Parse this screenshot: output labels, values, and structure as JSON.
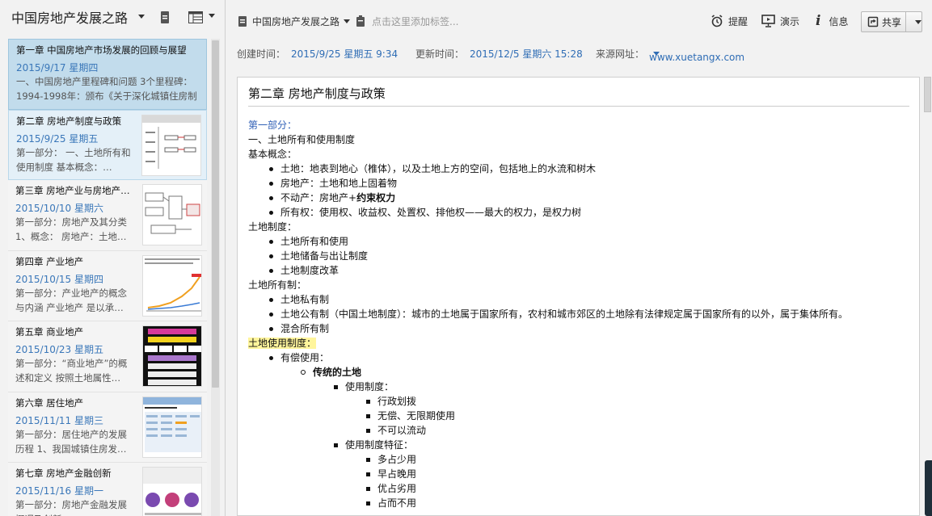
{
  "notebook": {
    "title": "中国房地产发展之路"
  },
  "notes": [
    {
      "title": "第一章 中国房地产市场发展的回顾与展望",
      "date": "2015/9/17 星期四",
      "snippet": "一、中国房地产里程碑和问题 3个里程碑： 1994-1998年：颁布《关于深化城镇住房制度改革的决定》…",
      "thumb": false
    },
    {
      "title": "第二章 房地产制度与政策",
      "date": "2015/9/25 星期五",
      "snippet": "第一部分： 一、土地所有和使用制度 基本概念：…",
      "thumb": true
    },
    {
      "title": "第三章 房地产业与房地产…",
      "date": "2015/10/10 星期六",
      "snippet": "第一部分：房地产及其分类 1、概念： 房地产：土地…",
      "thumb": true
    },
    {
      "title": "第四章 产业地产",
      "date": "2015/10/15 星期四",
      "snippet": "第一部分：产业地产的概念与内涵 产业地产 是以承…",
      "thumb": true
    },
    {
      "title": "第五章 商业地产",
      "date": "2015/10/23 星期五",
      "snippet": "第一部分：“商业地产”的概述和定义 按照土地属性…",
      "thumb": true
    },
    {
      "title": "第六章 居住地产",
      "date": "2015/11/11 星期三",
      "snippet": "第一部分：居住地产的发展历程 1、我国城镇住房发…",
      "thumb": true
    },
    {
      "title": "第七章 房地产金融创新",
      "date": "2015/11/16 星期一",
      "snippet": "第一部分：房地产金融发展概况及创新…",
      "thumb": true
    }
  ],
  "toolbar": {
    "note_title": "中国房地产发展之路",
    "tag_placeholder": "点击这里添加标签...",
    "remind": "提醒",
    "present": "演示",
    "info": "信息",
    "share": "共享"
  },
  "meta": {
    "created_label": "创建时间：",
    "created": "2015/9/25 星期五 9:34",
    "updated_label": "更新时间：",
    "updated": "2015/12/5 星期六 15:28",
    "source_label": "来源网址：",
    "source": "www.xuetangx.com"
  },
  "content": {
    "title": "第二章 房地产制度与政策",
    "lines": [
      {
        "text": "第一部分：",
        "indent": 0,
        "bullet": "none",
        "style": "blue"
      },
      {
        "text": "一、土地所有和使用制度",
        "indent": 0,
        "bullet": "none",
        "style": ""
      },
      {
        "text": "基本概念：",
        "indent": 0,
        "bullet": "none",
        "style": ""
      },
      {
        "text": "土地：地表到地心（椎体），以及土地上方的空间，包括地上的水流和树木",
        "indent": 1,
        "bullet": "disc",
        "style": ""
      },
      {
        "text": "房地产：土地和地上固着物",
        "indent": 1,
        "bullet": "disc",
        "style": ""
      },
      {
        "text": "不动产：房地产+",
        "bold": "约束权力",
        "indent": 1,
        "bullet": "disc",
        "style": ""
      },
      {
        "text": "所有权：使用权、收益权、处置权、排他权——最大的权力，是权力树",
        "indent": 1,
        "bullet": "disc",
        "style": ""
      },
      {
        "text": "土地制度：",
        "indent": 0,
        "bullet": "none",
        "style": ""
      },
      {
        "text": "土地所有和使用",
        "indent": 1,
        "bullet": "disc",
        "style": ""
      },
      {
        "text": "土地储备与出让制度",
        "indent": 1,
        "bullet": "disc",
        "style": ""
      },
      {
        "text": "土地制度改革",
        "indent": 1,
        "bullet": "disc",
        "style": ""
      },
      {
        "text": "土地所有制：",
        "indent": 0,
        "bullet": "none",
        "style": ""
      },
      {
        "text": "土地私有制",
        "indent": 1,
        "bullet": "disc",
        "style": ""
      },
      {
        "text": "土地公有制（中国土地制度）：城市的土地属于国家所有，农村和城市郊区的土地除有法律规定属于国家所有的以外，属于集体所有。",
        "indent": 1,
        "bullet": "disc",
        "style": ""
      },
      {
        "text": "混合所有制",
        "indent": 1,
        "bullet": "disc",
        "style": ""
      },
      {
        "text": "土地使用制度：",
        "indent": 0,
        "bullet": "none",
        "style": "hl"
      },
      {
        "text": "有偿使用：",
        "indent": 1,
        "bullet": "disc",
        "style": ""
      },
      {
        "text": "传统的土地",
        "indent": 2,
        "bullet": "circ",
        "style": "bold"
      },
      {
        "text": "使用制度：",
        "indent": 3,
        "bullet": "sq",
        "style": ""
      },
      {
        "text": "行政划拨",
        "indent": 4,
        "bullet": "sq",
        "style": ""
      },
      {
        "text": "无偿、无限期使用",
        "indent": 4,
        "bullet": "sq",
        "style": ""
      },
      {
        "text": "不可以流动",
        "indent": 4,
        "bullet": "sq",
        "style": ""
      },
      {
        "text": "使用制度特征：",
        "indent": 3,
        "bullet": "sq",
        "style": ""
      },
      {
        "text": "多占少用",
        "indent": 4,
        "bullet": "sq",
        "style": ""
      },
      {
        "text": "早占晚用",
        "indent": 4,
        "bullet": "sq",
        "style": ""
      },
      {
        "text": "优占劣用",
        "indent": 4,
        "bullet": "sq",
        "style": ""
      },
      {
        "text": "占而不用",
        "indent": 4,
        "bullet": "sq",
        "style": ""
      }
    ]
  },
  "colors": {
    "accent": "#2f6db5",
    "selected": "#c2dcec",
    "highlight": "#fff59c"
  }
}
